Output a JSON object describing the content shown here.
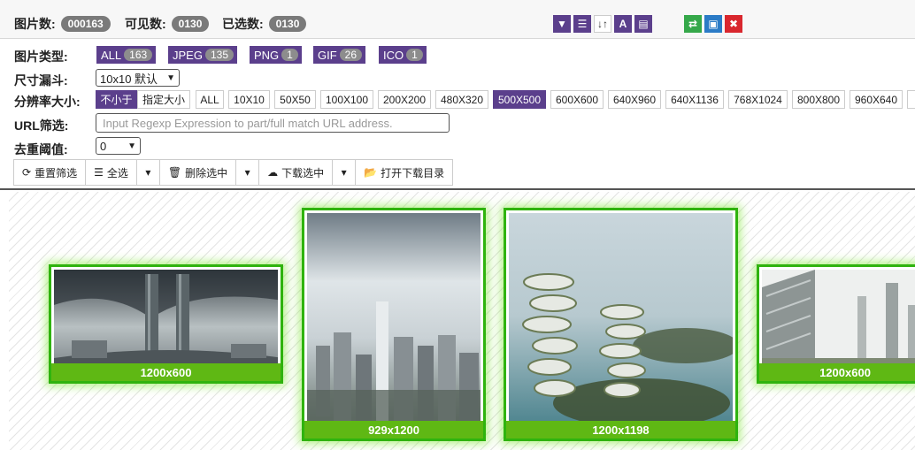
{
  "stats": {
    "total_label": "图片数:",
    "total": "000163",
    "visible_label": "可见数:",
    "visible": "0130",
    "selected_label": "已选数:",
    "selected": "0130"
  },
  "toolbar_icons": [
    {
      "name": "filter-icon",
      "color": "#5b3f8c",
      "glyph": "▼"
    },
    {
      "name": "list-icon",
      "color": "#5b3f8c",
      "glyph": "☰"
    },
    {
      "name": "sort-icon",
      "color": "#ffffff",
      "glyph": "↓↑"
    },
    {
      "name": "text-icon",
      "color": "#5b3f8c",
      "glyph": "A"
    },
    {
      "name": "settings-icon",
      "color": "#5b3f8c",
      "glyph": "▤"
    },
    {
      "name": "swap-icon",
      "color": "#35a84a",
      "glyph": "⇄"
    },
    {
      "name": "file-icon",
      "color": "#2b7bc6",
      "glyph": "▣"
    },
    {
      "name": "close-icon",
      "color": "#d9272e",
      "glyph": "✖"
    }
  ],
  "filters": {
    "type_label": "图片类型:",
    "types": [
      {
        "label": "ALL",
        "count": "163"
      },
      {
        "label": "JPEG",
        "count": "135"
      },
      {
        "label": "PNG",
        "count": "1"
      },
      {
        "label": "GIF",
        "count": "26"
      },
      {
        "label": "ICO",
        "count": "1"
      }
    ],
    "size_label": "尺寸漏斗:",
    "size_value": "10x10 默认",
    "res_label": "分辨率大小:",
    "res_mode_a": "不小于",
    "res_mode_b": "指定大小",
    "resolutions": [
      "ALL",
      "10X10",
      "50X50",
      "100X100",
      "200X200",
      "480X320",
      "500X500",
      "600X600",
      "640X960",
      "640X1136",
      "768X1024",
      "800X800",
      "960X640"
    ],
    "res_selected": "500X500",
    "url_label": "URL筛选:",
    "url_placeholder": "Input Regexp Expression to part/full match URL address.",
    "dedup_label": "去重阈值:",
    "dedup_value": "0"
  },
  "actions": {
    "reset": "重置筛选",
    "select_all": "全选",
    "delete_selected": "删除选中",
    "download_selected": "下载选中",
    "open_dir": "打开下载目录"
  },
  "images": [
    {
      "size": "1200x600"
    },
    {
      "size": "929x1200"
    },
    {
      "size": "1200x1198"
    },
    {
      "size": "1200x600"
    }
  ],
  "colors": {
    "accent": "#5b3f8c",
    "card_border": "#2fb30e",
    "caption": "#5fb814"
  }
}
